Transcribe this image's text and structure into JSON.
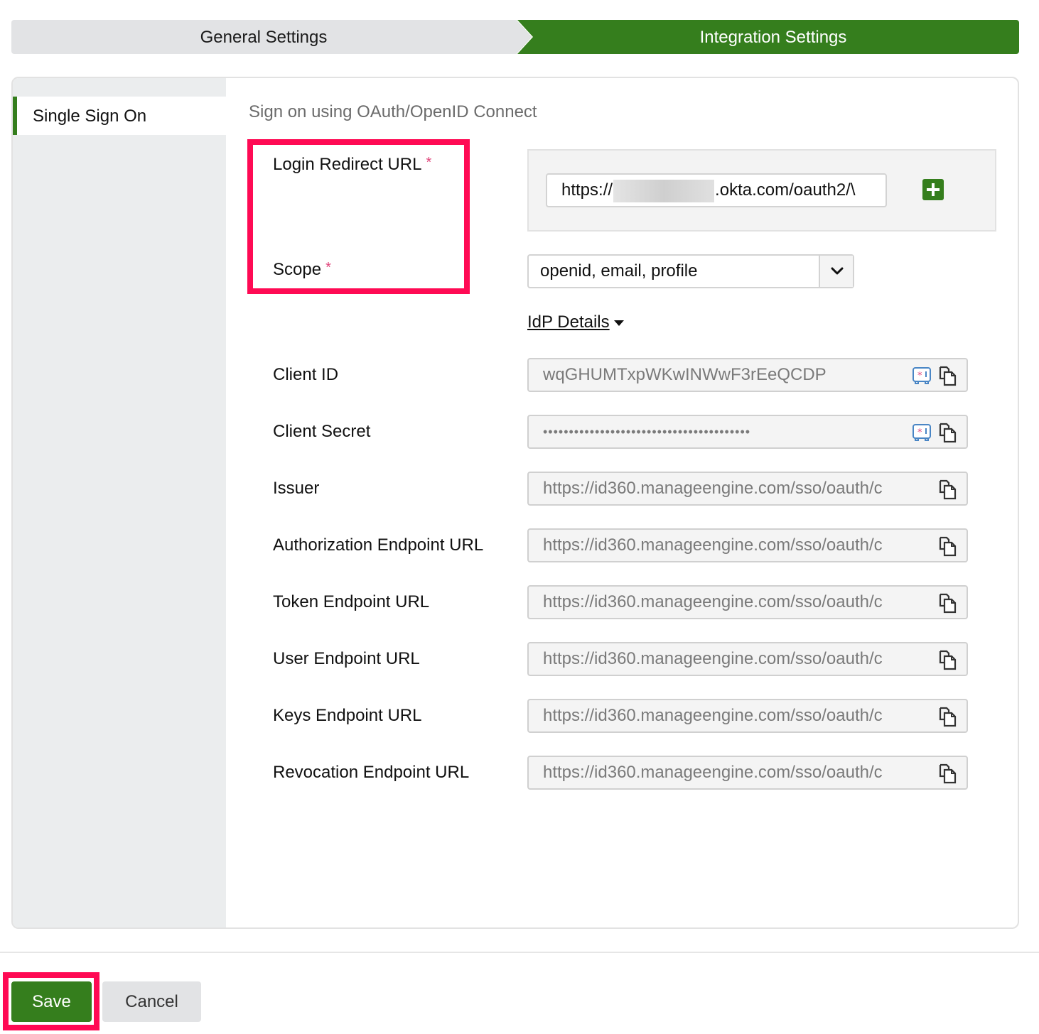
{
  "steps": {
    "general": "General Settings",
    "integration": "Integration Settings",
    "active": "Integration Settings"
  },
  "sidebar": {
    "items": [
      {
        "label": "Single Sign On",
        "active": true
      }
    ]
  },
  "form": {
    "section_title": "Sign on using OAuth/OpenID Connect",
    "login_redirect": {
      "label": "Login Redirect URL",
      "required_mark": "*",
      "value_prefix": "https://",
      "value_suffix": ".okta.com/oauth2/\\",
      "add_icon": "plus-icon"
    },
    "scope": {
      "label": "Scope",
      "required_mark": "*",
      "selected": "openid, email, profile",
      "dropdown_icon": "chevron-down-icon"
    },
    "idp_details": {
      "toggle_label": "IdP Details",
      "toggle_icon": "caret-down-icon",
      "fields": [
        {
          "label": "Client ID",
          "value": "wqGHUMTxpWKwINWwF3rEeQCDP",
          "icons": [
            "vault-icon",
            "copy-icon"
          ]
        },
        {
          "label": "Client Secret",
          "value": "••••••••••••••••••••••••••••••••••••••••",
          "icons": [
            "vault-icon",
            "copy-icon"
          ]
        },
        {
          "label": "Issuer",
          "value": "https://id360.manageengine.com/sso/oauth/c",
          "icons": [
            "copy-icon"
          ]
        },
        {
          "label": "Authorization Endpoint URL",
          "value": "https://id360.manageengine.com/sso/oauth/c",
          "icons": [
            "copy-icon"
          ]
        },
        {
          "label": "Token Endpoint URL",
          "value": "https://id360.manageengine.com/sso/oauth/c",
          "icons": [
            "copy-icon"
          ]
        },
        {
          "label": "User Endpoint URL",
          "value": "https://id360.manageengine.com/sso/oauth/c",
          "icons": [
            "copy-icon"
          ]
        },
        {
          "label": "Keys Endpoint URL",
          "value": "https://id360.manageengine.com/sso/oauth/c",
          "icons": [
            "copy-icon"
          ]
        },
        {
          "label": "Revocation Endpoint URL",
          "value": "https://id360.manageengine.com/sso/oauth/c",
          "icons": [
            "copy-icon"
          ]
        }
      ]
    }
  },
  "footer": {
    "save_label": "Save",
    "cancel_label": "Cancel"
  },
  "colors": {
    "brand_green": "#357e1d",
    "highlight": "#ff0a54",
    "required": "#e0457b"
  }
}
